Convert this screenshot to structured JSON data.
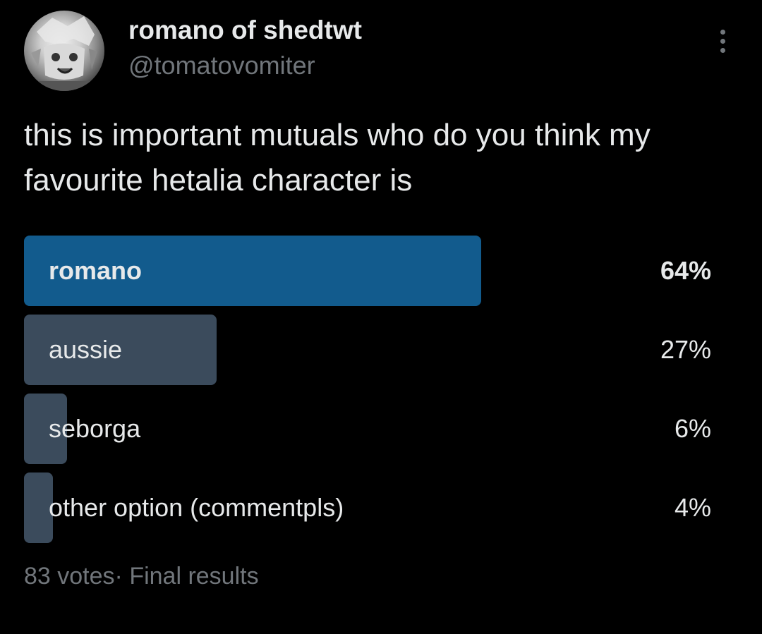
{
  "author": {
    "display_name": "romano of shedtwt",
    "handle": "@tomatovomiter",
    "avatar_icon": "profile-avatar"
  },
  "more_icon": "more-dots-icon",
  "tweet": {
    "text": "this is important mutuals who do you think my favourite hetalia character is"
  },
  "poll": {
    "options": [
      {
        "label": "romano",
        "percent_text": "64%",
        "percent": 64,
        "winner": true
      },
      {
        "label": "aussie",
        "percent_text": "27%",
        "percent": 27,
        "winner": false
      },
      {
        "label": "seborga",
        "percent_text": "6%",
        "percent": 6,
        "winner": false
      },
      {
        "label": "other option (commentpls)",
        "percent_text": "4%",
        "percent": 4,
        "winner": false
      }
    ],
    "votes": "83 votes",
    "separator": "·",
    "status": "Final results"
  },
  "colors": {
    "background": "#000000",
    "winner_bar": "#125b8d",
    "bar": "#3b4b5c",
    "secondary_text": "#71767b",
    "primary_text": "#e7e9ea"
  }
}
